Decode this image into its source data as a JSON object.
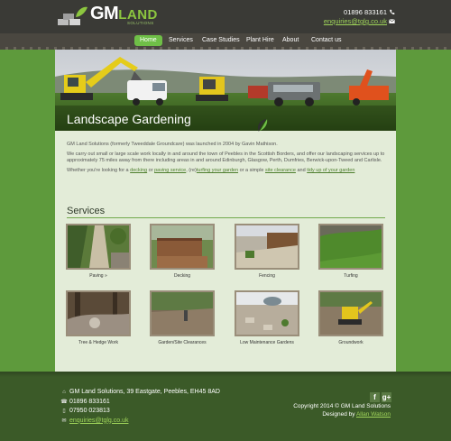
{
  "header": {
    "logo_text": "GM",
    "logo_land": "LAND",
    "logo_sub": "SOLUTIONS",
    "phone": "01896 833161",
    "email": "enquiries@tglg.co.uk"
  },
  "nav": {
    "items": [
      {
        "label": "Home",
        "active": true
      },
      {
        "label": "Services",
        "active": false
      },
      {
        "label": "Case Studies",
        "active": false
      },
      {
        "label": "Plant Hire",
        "active": false
      },
      {
        "label": "About",
        "active": false
      },
      {
        "label": "Contact us",
        "active": false
      }
    ]
  },
  "hero": {
    "title": "Landscape Gardening"
  },
  "intro": {
    "p1": "GM Land Solutions (formerly Tweeddale Groundcare) was launched in 2004 by Gavin Mathison.",
    "p2": "We carry out small or large scale work locally in and around the town of Peebles in the Scottish Borders, and offer our landscaping services up to approximately 75 miles away from there including areas in and around Edinburgh, Glasgow, Perth, Dumfries, Berwick-upon-Tweed and Carlisle.",
    "p3_a": "Whether you're looking for a ",
    "link_decking": "decking",
    "p3_b": " or ",
    "link_paving": "paving service",
    "p3_c": ", (re)",
    "link_turfing": "turfing your garden",
    "p3_d": " or a simple ",
    "link_site": "site clearance",
    "p3_e": " and ",
    "link_tidy": "tidy up of your garden"
  },
  "services": {
    "title": "Services",
    "tiles": [
      {
        "label": "Paving »"
      },
      {
        "label": "Decking"
      },
      {
        "label": "Fencing"
      },
      {
        "label": "Turfing"
      },
      {
        "label": "Tree & Hedge Work"
      },
      {
        "label": "Garden/Site Clearances"
      },
      {
        "label": "Low Maintenance Gardens"
      },
      {
        "label": "Groundwork"
      }
    ]
  },
  "footer": {
    "address": "GM Land Solutions, 39 Eastgate, Peebles, EH45 8AD",
    "phone1": "01896 833161",
    "phone2": "07950 023813",
    "email": "enquiries@tglg.co.uk",
    "copyright": "Copyright 2014 © GM Land Solutions",
    "designed_by": "Designed by ",
    "designer": "Allan Watson",
    "social_f": "f",
    "social_g": "g+"
  },
  "colors": {
    "accent_green": "#6fbf47",
    "page_green": "#5e9a3c",
    "header_dark": "#3a3a36",
    "footer_green": "#3b5a28",
    "content_bg": "#e3ecd8"
  },
  "icons": [
    "phone-icon",
    "mail-icon",
    "home-icon",
    "mobile-icon",
    "facebook-icon",
    "googleplus-icon",
    "leaf-icon"
  ]
}
